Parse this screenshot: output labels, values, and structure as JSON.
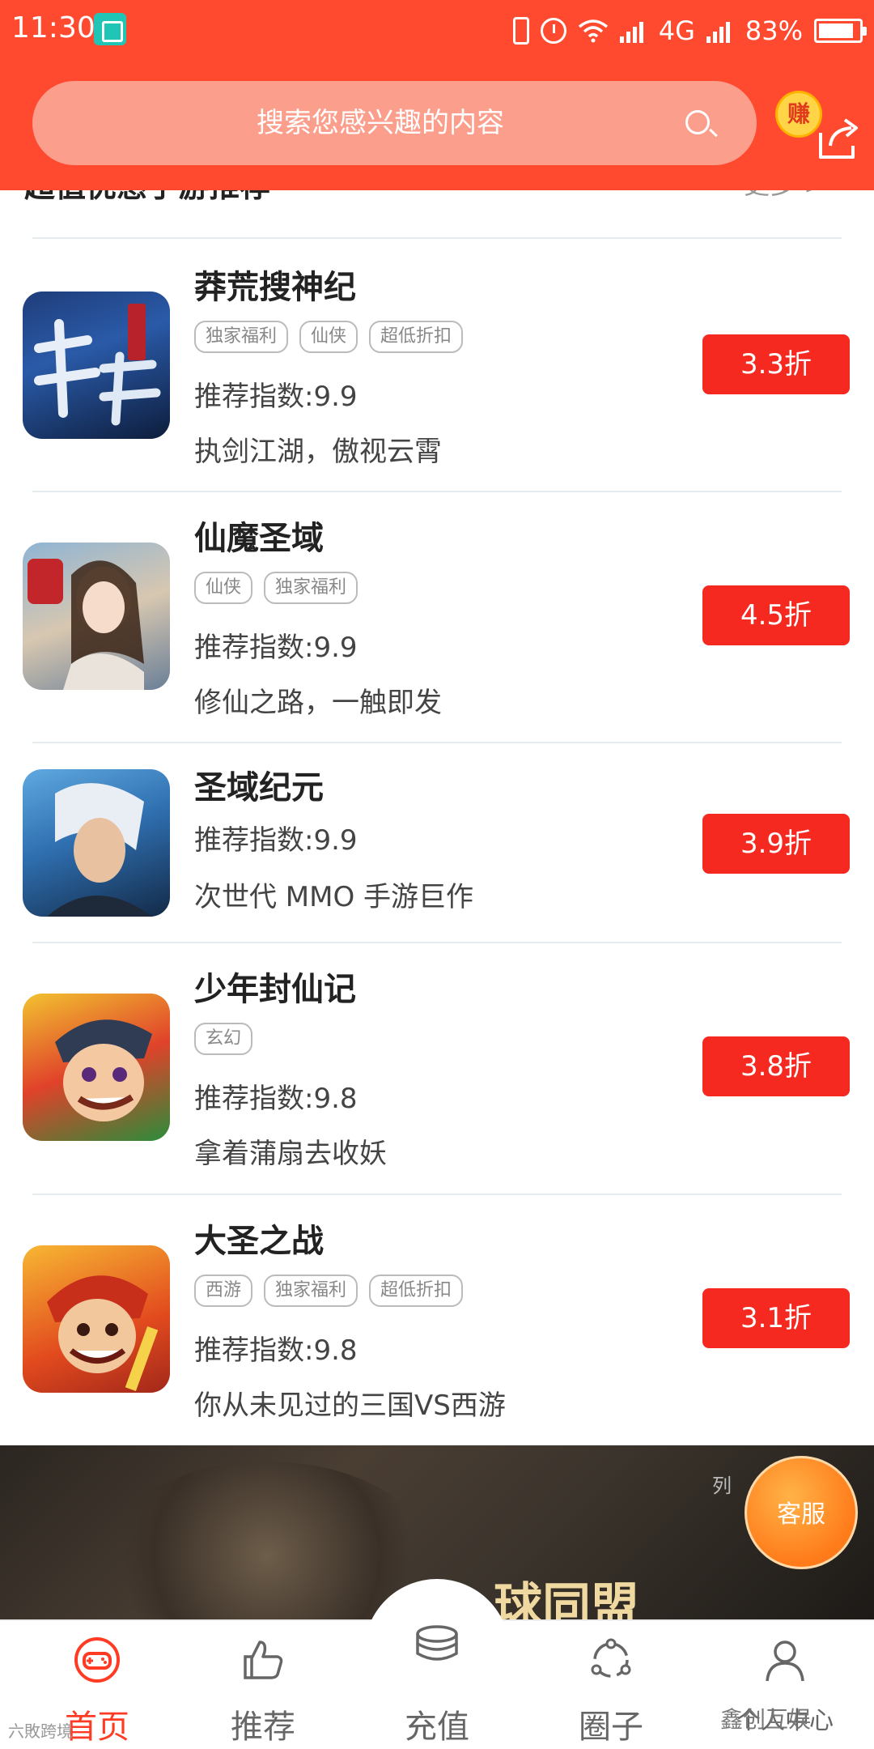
{
  "status_bar": {
    "time": "11:30",
    "network": "4G",
    "battery": "83%"
  },
  "search": {
    "placeholder": "搜索您感兴趣的内容"
  },
  "header": {
    "earn_badge": "赚"
  },
  "section": {
    "title": "超值优惠手游推荐",
    "more": "更多 >"
  },
  "games": [
    {
      "name": "莽荒搜神纪",
      "tags": [
        "独家福利",
        "仙侠",
        "超低折扣"
      ],
      "rating": "推荐指数:9.9",
      "desc": "执剑江湖，傲视云霄",
      "discount": "3.3折",
      "icon": "mang-huang-game-icon"
    },
    {
      "name": "仙魔圣域",
      "tags": [
        "仙侠",
        "独家福利"
      ],
      "rating": "推荐指数:9.9",
      "desc": "修仙之路，一触即发",
      "discount": "4.5折",
      "icon": "xian-mo-game-icon"
    },
    {
      "name": "圣域纪元",
      "tags": [],
      "rating": "推荐指数:9.9",
      "desc": "次世代 MMO 手游巨作",
      "discount": "3.9折",
      "icon": "sheng-yu-game-icon"
    },
    {
      "name": "少年封仙记",
      "tags": [
        "玄幻"
      ],
      "rating": "推荐指数:9.8",
      "desc": "拿着蒲扇去收妖",
      "discount": "3.8折",
      "icon": "shao-nian-game-icon"
    },
    {
      "name": "大圣之战",
      "tags": [
        "西游",
        "独家福利",
        "超低折扣"
      ],
      "rating": "推荐指数:9.8",
      "desc": "你从未见过的三国VS西游",
      "discount": "3.1折",
      "icon": "da-sheng-game-icon"
    }
  ],
  "banner": {
    "text": "球同盟",
    "logo": "列"
  },
  "service": {
    "label": "客服"
  },
  "tabs": [
    {
      "label": "首页",
      "icon": "gamepad-icon",
      "active": true
    },
    {
      "label": "推荐",
      "icon": "thumbs-up-icon",
      "active": false
    },
    {
      "label": "充值",
      "icon": "coins-icon",
      "active": false
    },
    {
      "label": "圈子",
      "icon": "circle-share-icon",
      "active": false
    },
    {
      "label": "个人中心",
      "icon": "person-icon",
      "active": false
    }
  ],
  "watermarks": {
    "left": "六敗跨境",
    "right": "鑫创互娱"
  },
  "colors": {
    "brand_red": "#ff4a2f",
    "discount_red": "#f5291f",
    "active_tab": "#ff3b24",
    "service_orange": "#ff7b1a"
  }
}
